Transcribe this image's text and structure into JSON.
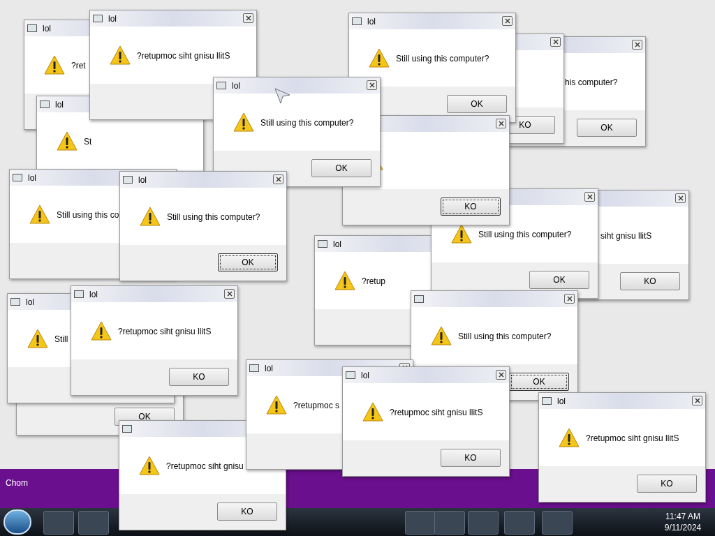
{
  "desktop": {
    "label": "Chom"
  },
  "dialogs": [
    {
      "title": "lol",
      "message": "?ret"
    },
    {
      "title": "lol",
      "message": "St"
    },
    {
      "title": "lol",
      "message": "?retupmoc siht gnisu llitS"
    },
    {
      "button": {
        "label": "KO",
        "focused": false
      }
    },
    {
      "message": "his computer?",
      "button": {
        "label": "OK",
        "focused": false
      }
    },
    {
      "title": "lol",
      "message": "Still using this computer?",
      "button": {
        "label": "OK",
        "focused": false
      }
    },
    {
      "message": "siht gnisu llitS",
      "button": {
        "label": "KO",
        "focused": false
      }
    },
    {
      "title": "lol",
      "message": "Still using this co"
    },
    {
      "title": "lol",
      "message": "?retup"
    },
    {
      "message": "Still using this computer?",
      "button": {
        "label": "OK",
        "focused": false
      }
    },
    {
      "button": {
        "label": "KO",
        "focused": true
      }
    },
    {
      "title": "lol",
      "message": "Still using this computer?",
      "button": {
        "label": "OK",
        "focused": false
      }
    },
    {
      "message": "Still using this computer?",
      "button": {
        "label": "OK",
        "focused": true
      }
    },
    {
      "title": "lol",
      "message": "Still using this computer?",
      "button": {
        "label": "OK",
        "focused": true
      }
    },
    {
      "button": {
        "label": "OK",
        "focused": false
      }
    },
    {
      "title": "lol",
      "message": "Still"
    },
    {
      "title": "lol",
      "message": "?retupmoc siht gnisu llitS",
      "button": {
        "label": "KO",
        "focused": false
      }
    },
    {
      "message": "?retupmoc siht gnisu",
      "button": {
        "label": "KO",
        "focused": false
      }
    },
    {
      "title": "lol",
      "message": "?retupmoc s"
    },
    {
      "title": "lol",
      "message": "?retupmoc siht gnisu llitS",
      "button": {
        "label": "KO",
        "focused": false
      }
    },
    {
      "title": "lol",
      "message": "?retupmoc siht gnisu llitS",
      "button": {
        "label": "KO",
        "focused": false
      }
    }
  ],
  "taskbar": {
    "time": "11:47 AM",
    "date": "9/11/2024"
  }
}
